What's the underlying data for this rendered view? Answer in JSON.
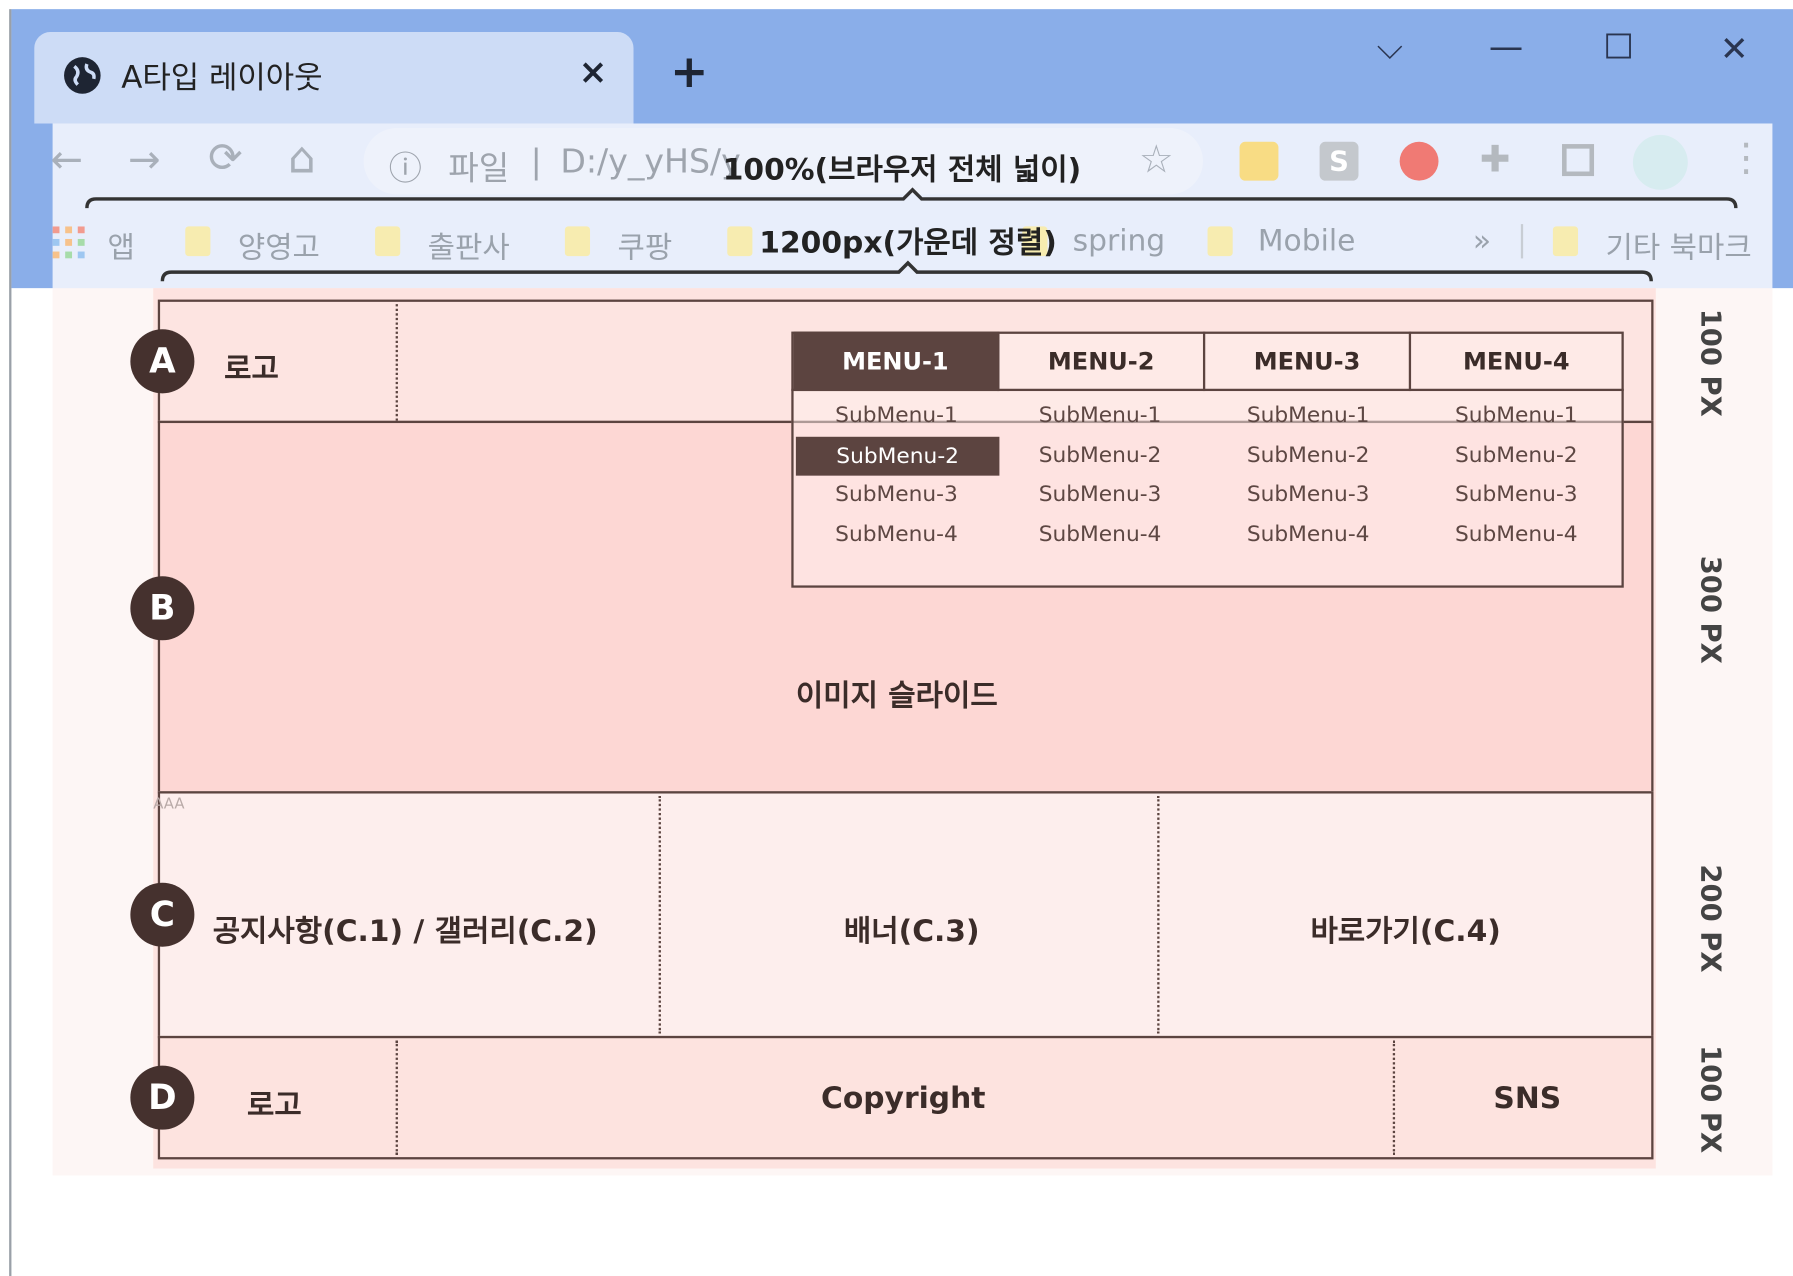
{
  "browser": {
    "tab_title": "A타입 레이아웃",
    "tab_close": "×",
    "new_tab": "+",
    "win_chevron": "⌵",
    "win_minimize": "—",
    "win_maximize": "☐",
    "win_close": "✕",
    "nav_back": "←",
    "nav_forward": "→",
    "nav_reload": "⟳",
    "nav_home": "⌂",
    "info": "ⓘ",
    "url_scheme": "파일",
    "url_separator": "|",
    "url_path": "D:/y_yHS/y",
    "star": "☆",
    "ext_s": "S",
    "ext_puzzle": "✚",
    "menu_dots": "⋮",
    "bookmarks": [
      "앱",
      "양영고",
      "출판사",
      "쿠팡",
      "spring",
      "Mobile"
    ],
    "bookmarks_more": "»",
    "bookmarks_other": "기타 북마크"
  },
  "annotations": {
    "full_width": "100%(브라우저 전체 넓이)",
    "center_width": "1200px(가운데 정렬)",
    "marker": "AAA"
  },
  "layout": {
    "header": {
      "marker": "A",
      "logo": "로고",
      "height": "100 PX"
    },
    "menu": {
      "headers": [
        "MENU-1",
        "MENU-2",
        "MENU-3",
        "MENU-4"
      ],
      "submenus": [
        "SubMenu-1",
        "SubMenu-2",
        "SubMenu-3",
        "SubMenu-4"
      ]
    },
    "slide": {
      "marker": "B",
      "label": "이미지 슬라이드",
      "height": "300 PX"
    },
    "content": {
      "marker": "C",
      "c1": "공지사항(C.1) / 갤러리(C.2)",
      "c3": "배너(C.3)",
      "c4": "바로가기(C.4)",
      "height": "200 PX"
    },
    "footer": {
      "marker": "D",
      "logo": "로고",
      "copyright": "Copyright",
      "sns": "SNS",
      "height": "100 PX"
    }
  },
  "colors": {
    "menu_active": "#5c4440",
    "region_border": "#5c4440",
    "overlay": "#fde3e0",
    "browser_frame": "#8aaee9"
  }
}
